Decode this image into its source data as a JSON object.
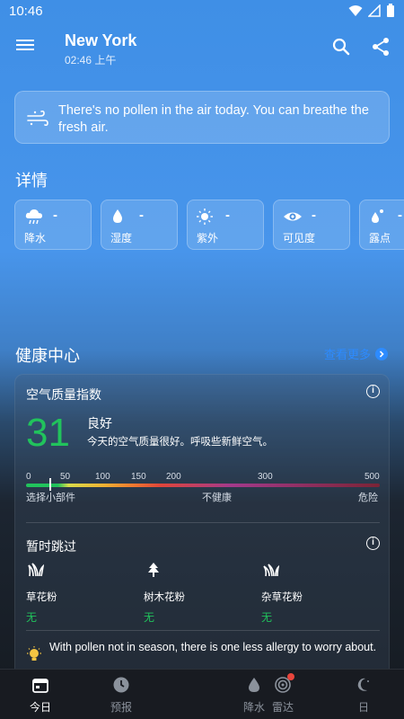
{
  "status_bar": {
    "time": "10:46"
  },
  "header": {
    "city": "New York",
    "local_time": "02:46 上午"
  },
  "pollen_banner": {
    "text": "There's no pollen in the air today. You can breathe the fresh air."
  },
  "details": {
    "title": "详情",
    "items": [
      {
        "icon": "rain-cloud-icon",
        "value": "-",
        "label": "降水"
      },
      {
        "icon": "droplet-icon",
        "value": "-",
        "label": "湿度"
      },
      {
        "icon": "sun-icon",
        "value": "-",
        "label": "紫外"
      },
      {
        "icon": "eye-icon",
        "value": "-",
        "label": "可见度"
      },
      {
        "icon": "dew-point-icon",
        "value": "-",
        "label": "露点"
      }
    ]
  },
  "health_center": {
    "title": "健康中心",
    "see_more": "查看更多",
    "aqi": {
      "title": "空气质量指数",
      "value": "31",
      "level": "良好",
      "description": "今天的空气质量很好。呼吸些新鲜空气。",
      "scale_labels": [
        "0",
        "50",
        "100",
        "150",
        "200",
        "300",
        "500"
      ],
      "caption_left": "选择小部件",
      "caption_mid": "不健康",
      "caption_right": "危险"
    },
    "pollen": {
      "title": "暂时跳过",
      "items": [
        {
          "icon": "grass-icon",
          "name": "草花粉",
          "value": "无"
        },
        {
          "icon": "tree-icon",
          "name": "树木花粉",
          "value": "无"
        },
        {
          "icon": "weed-icon",
          "name": "杂草花粉",
          "value": "无"
        }
      ],
      "tip": "With pollen not in season, there is one less allergy to worry about."
    }
  },
  "bottom_nav": [
    {
      "icon": "calendar-icon",
      "label": "今日",
      "active": true
    },
    {
      "icon": "clock-icon",
      "label": "预报",
      "active": false
    },
    {
      "icon": "precip-drop-icon",
      "label": "降水",
      "active": false
    },
    {
      "icon": "radar-icon",
      "label": "雷达",
      "active": false
    },
    {
      "icon": "moon-icon",
      "label": "日",
      "active": false
    }
  ],
  "colors": {
    "good_green": "#21c35c",
    "link_blue": "#2d8bff",
    "radar_dot": "#e8453c"
  }
}
